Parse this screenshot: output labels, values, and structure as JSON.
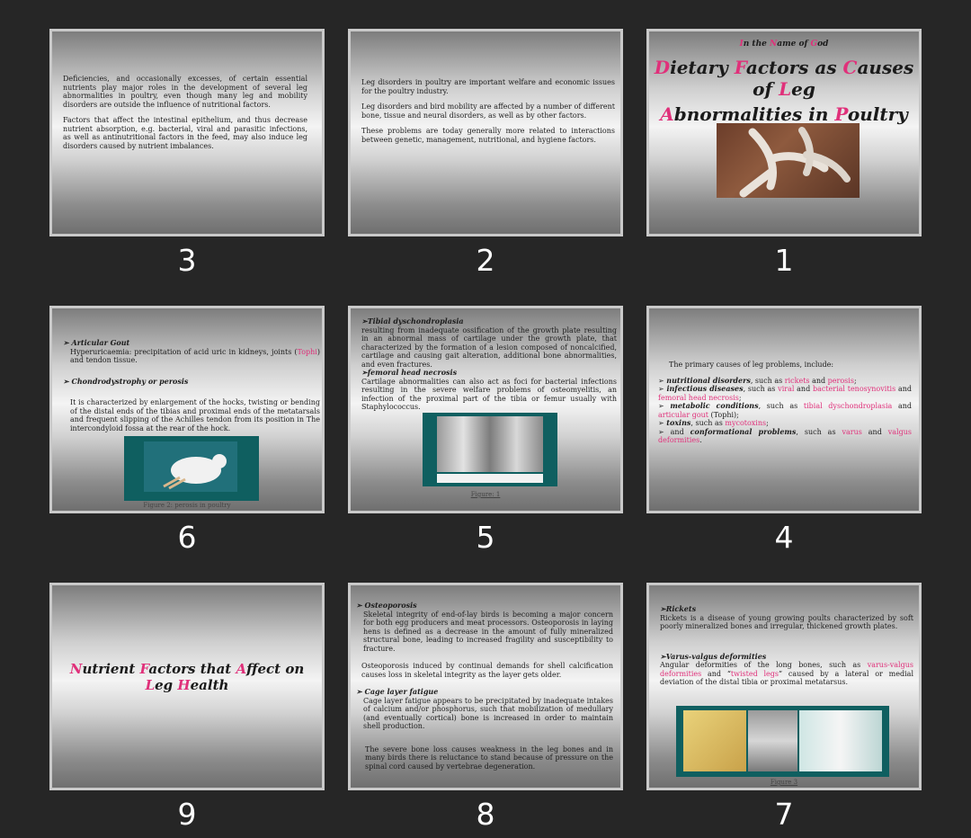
{
  "slides": [
    {
      "number": "3",
      "paragraphs": [
        "Deficiencies, and occasionally excesses, of certain essential nutrients play major roles in the development of several leg abnormalities in poultry, even though many leg and mobility disorders are outside the influence of nutritional factors.",
        "Factors that affect the intestinal epithelium, and thus decrease nutrient absorption, e.g. bacterial, viral and parasitic infections, as well as antinutritional factors in the feed, may also induce leg disorders caused by nutrient imbalances."
      ]
    },
    {
      "number": "2",
      "paragraphs": [
        "Leg disorders in poultry are important welfare and economic issues for the poultry industry.",
        "Leg disorders and bird mobility are affected by a number of different bone, tissue and neural disorders, as well as by other factors.",
        "These problems are today generally more related to interactions between genetic, management, nutritional, and hygiene factors."
      ]
    },
    {
      "number": "1",
      "top_line": "In the Name of God",
      "title_line1": "Dietary Factors as Causes",
      "title_line2": "of Leg",
      "title_line3": "Abnormalities in Poultry"
    },
    {
      "number": "6",
      "h1": "Articular Gout",
      "t1a": "Hyperuricaemia: precipitation of acid uric in kidneys, joints (",
      "t1b": "Tophi",
      "t1c": ") and tendon tissue.",
      "h2": "Chondrodystrophy or perosis",
      "t2": "It is characterized by enlargement of the hocks, twisting or bending of the distal ends of the tibias and proximal ends of the metatarsals and frequent slipping of the Achilles tendon from its position in The intercondyloid fossa at the rear of the hock.",
      "caption": "Figure 2: perosis in poultry"
    },
    {
      "number": "5",
      "h1": "Tibial dyschondroplasia",
      "t1": "resulting from inadequate ossification of the growth plate resulting in an abnormal mass of cartilage under the growth plate, that characterized by the formation of a lesion composed of noncalcified, cartilage and causing gait alteration, additional bone abnormalities, and even fractures.",
      "h2": "femoral head necrosis",
      "t2": "Cartilage abnormalities can also act as foci for bacterial infections resulting in the severe welfare problems of osteomyelitis, an infection of the proximal part of the tibia or femur usually with Staphylococcus.",
      "caption": "Figure: 1"
    },
    {
      "number": "4",
      "intro": "The primary causes of leg problems, include:",
      "b1_head": "nutritional disorders",
      "b1_mid": ", such as ",
      "b1_p1": "rickets",
      "b1_and": " and ",
      "b1_p2": "perosis",
      "b1_end": ";",
      "b2_head": "infectious diseases",
      "b2_mid": ", such as ",
      "b2_p1": "viral",
      "b2_and": " and ",
      "b2_p2": "bacterial tenosynovitis",
      "b2_and2": " and ",
      "b2_p3": "femoral head necrosis",
      "b2_end": ";",
      "b3_head": "metabolic conditions",
      "b3_mid": ", such as ",
      "b3_p1": "tibial dyschondroplasia",
      "b3_and": " and ",
      "b3_p2": "articular gout",
      "b3_end": " (Tophi);",
      "b4_head": "toxins",
      "b4_mid": ", such as ",
      "b4_p1": "mycotoxins",
      "b4_end": ";",
      "b5_pre": "and ",
      "b5_head": "conformational problems",
      "b5_mid": ", such as ",
      "b5_p1": "varus",
      "b5_and": " and ",
      "b5_p2": "valgus deformities",
      "b5_end": "."
    },
    {
      "number": "9",
      "title_line1": "Nutrient Factors that Affect on",
      "title_line2": "Leg Health"
    },
    {
      "number": "8",
      "h1": "Osteoporosis",
      "t1": "Skeletal integrity of end-of-lay birds is becoming a major concern for both egg producers and meat processors. Osteoporosis in laying hens is defined as a decrease in the amount of fully mineralized structural bone, leading to increased fragility and susceptibility to fracture.",
      "t1b": "Osteoporosis induced by continual demands for shell calcification causes loss in skeletal integrity as the layer gets older.",
      "h2": "Cage layer fatigue",
      "t2": "Cage layer fatigue appears to be precipitated by inadequate intakes of calcium and/or phosphorus, such that mobilization of medullary (and eventually cortical) bone is increased in order to maintain shell production.",
      "t3": "The severe bone loss causes weakness in the leg bones and in many birds there is reluctance to stand because of pressure on the spinal cord caused by vertebrae degeneration."
    },
    {
      "number": "7",
      "h1": "Rickets",
      "t1": "Rickets is a disease of young growing poults characterized by soft poorly mineralized bones and irregular, thickened growth plates.",
      "h2": "Varus-valgus deformities",
      "t2a": "Angular deformities of the long bones, such as ",
      "t2p1": "varus-valgus deformities",
      "t2b": " and “",
      "t2p2": "twisted legs",
      "t2c": "” caused by a lateral or medial deviation of the distal tibia or proximal metatarsus.",
      "caption": "Figure 3"
    }
  ]
}
